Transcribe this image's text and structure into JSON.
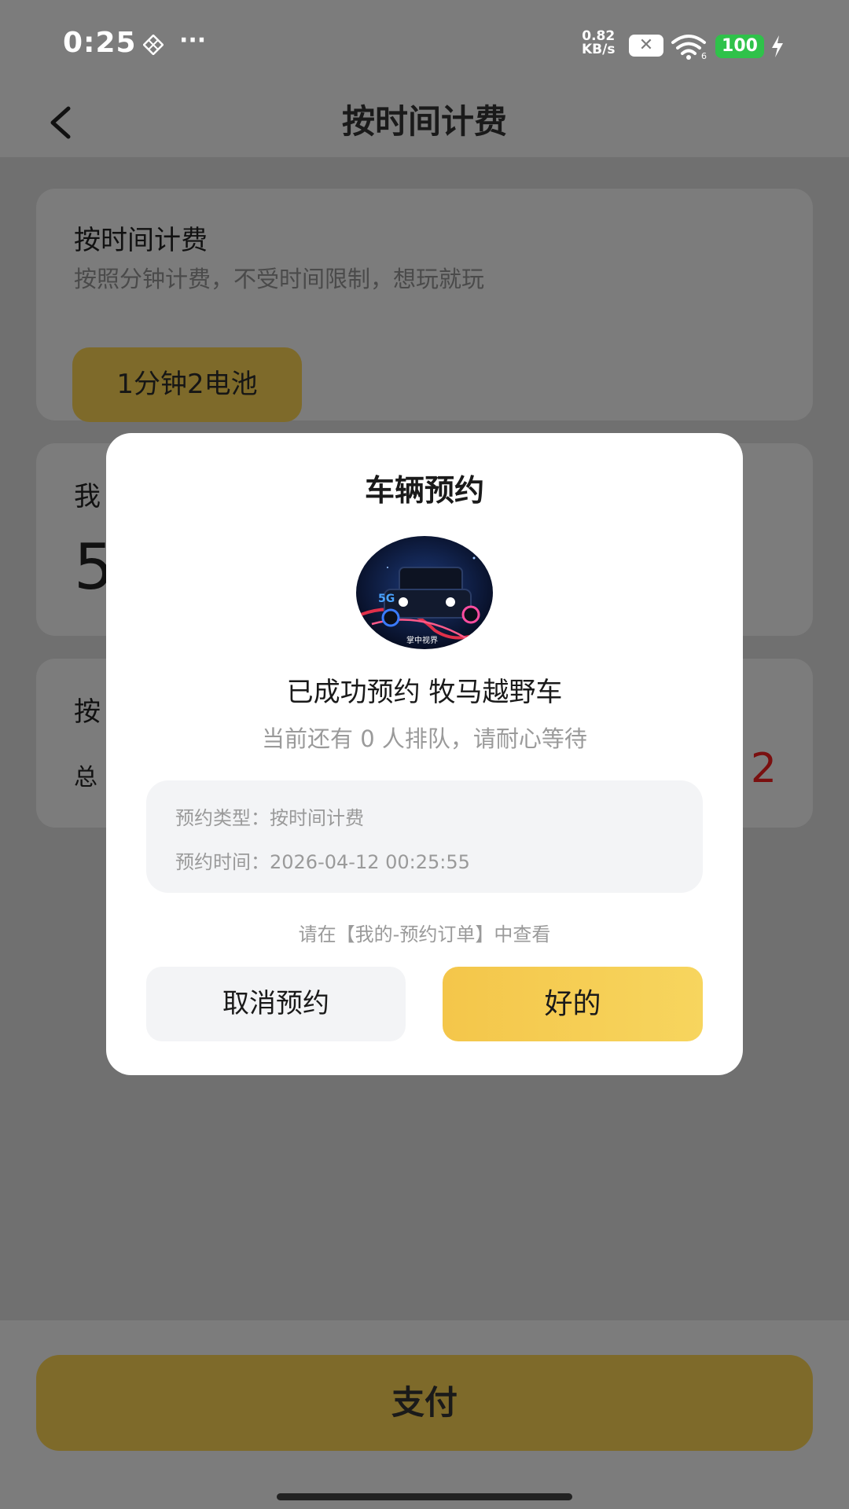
{
  "status_bar": {
    "time": "0:25",
    "more": "···",
    "net_speed_value": "0.82",
    "net_speed_unit": "KB/s",
    "wifi_label": "6",
    "battery": "100",
    "icons": [
      "diamond-grid-icon",
      "close-badge-icon",
      "wifi-icon",
      "battery-icon",
      "charging-bolt-icon"
    ]
  },
  "nav": {
    "title": "按时间计费"
  },
  "plan_card": {
    "title": "按时间计费",
    "description": "按照分钟计费，不受时间限制，想玩就玩",
    "price_option": "1分钟2电池"
  },
  "balance_card": {
    "label_visible": "我",
    "value_visible": "5"
  },
  "total_card": {
    "label_visible": "按",
    "total_visible": "总",
    "amount_visible": "2"
  },
  "pay_button": {
    "label": "支付"
  },
  "modal": {
    "title": "车辆预约",
    "success": "已成功预约 牧马越野车",
    "queue": "当前还有 0 人排队，请耐心等待",
    "type_label": "预约类型：",
    "type_value": "按时间计费",
    "time_label": "预约时间：",
    "time_value": "2026-04-12 00:25:55",
    "hint": "请在【我的-预约订单】中查看",
    "cancel_label": "取消预约",
    "ok_label": "好的",
    "avatar_badge": "5G",
    "avatar_caption": "掌中视界"
  },
  "colors": {
    "accent": "#f5c94f",
    "overlay_gray": "#7c7c7c",
    "amount_red": "#7a0f0f",
    "battery_green": "#2fc24a"
  }
}
